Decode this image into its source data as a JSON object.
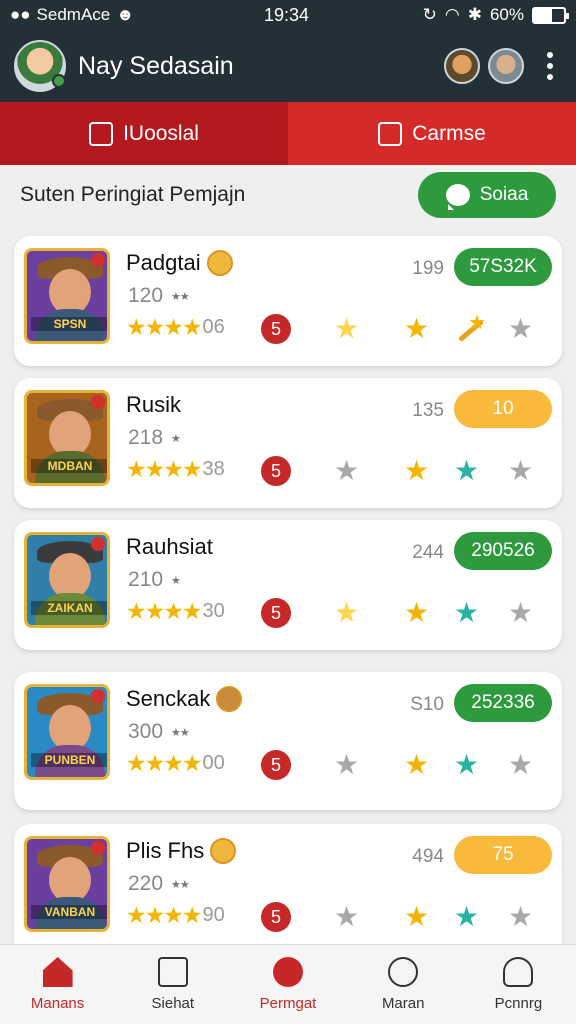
{
  "status_bar": {
    "carrier": "SedmAce",
    "time": "19:34",
    "battery": "60%",
    "battery_level": 0.6
  },
  "header": {
    "title": "Nay Sedasain"
  },
  "tabs": [
    {
      "label": "IUooslal",
      "active": true
    },
    {
      "label": "Carmse",
      "active": false
    }
  ],
  "section": {
    "title": "Suten Peringiat Pemjajn",
    "button_label": "Soiaa"
  },
  "players": [
    {
      "name": "Padgtai",
      "sub": "120",
      "rating_value": "06",
      "level": "5",
      "count": "199",
      "score": "57S32K",
      "score_color": "green",
      "art_label": "SPSN"
    },
    {
      "name": "Rusik",
      "sub": "218",
      "rating_value": "38",
      "level": "5",
      "count": "135",
      "score": "10",
      "score_color": "orange",
      "art_label": "MDBAN"
    },
    {
      "name": "Rauhsiat",
      "sub": "210",
      "rating_value": "30",
      "level": "5",
      "count": "244",
      "score": "290526",
      "score_color": "green",
      "art_label": "ZAIKAN"
    },
    {
      "name": "Senckak",
      "sub": "300",
      "rating_value": "00",
      "level": "5",
      "count": "S10",
      "score": "252336",
      "score_color": "green",
      "art_label": "PUNBEN"
    },
    {
      "name": "Plis Fhs",
      "sub": "220",
      "rating_value": "90",
      "level": "5",
      "count": "494",
      "score": "75",
      "score_color": "orange",
      "art_label": "VANBAN"
    }
  ],
  "bottom_nav": [
    {
      "label": "Manans",
      "icon": "home-icon"
    },
    {
      "label": "Siehat",
      "icon": "card-icon"
    },
    {
      "label": "Permgat",
      "icon": "heart-badge-icon"
    },
    {
      "label": "Maran",
      "icon": "person-icon"
    },
    {
      "label": "Pcnnrg",
      "icon": "profile-icon"
    }
  ],
  "colors": {
    "topbar": "#243038",
    "tab_active": "#b3191f",
    "tab_other": "#d42a2a",
    "green": "#2e9a3e",
    "orange": "#f9b93a"
  }
}
